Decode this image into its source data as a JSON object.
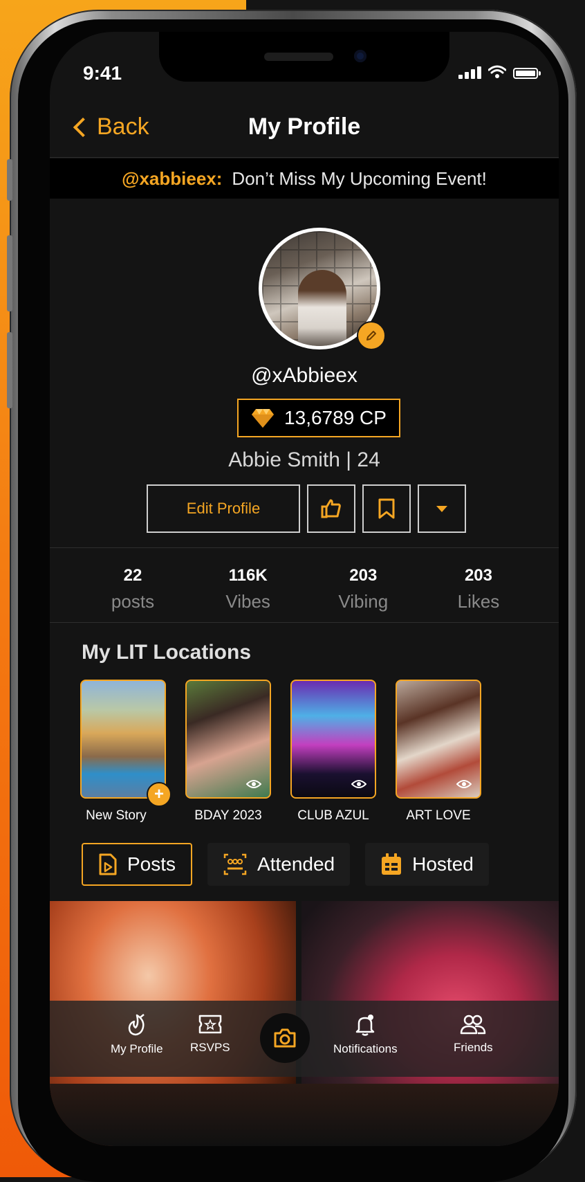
{
  "status_bar": {
    "time": "9:41"
  },
  "nav": {
    "back_label": "Back",
    "title": "My Profile"
  },
  "banner": {
    "handle": "@xabbieex:",
    "message": "Don’t Miss My Upcoming Event!"
  },
  "profile": {
    "username": "@xAbbieex",
    "points": "13,6789 CP",
    "name_age": "Abbie Smith | 24",
    "edit_profile_label": "Edit Profile"
  },
  "stats": [
    {
      "value": "22",
      "label": "posts"
    },
    {
      "value": "116K",
      "label": "Vibes"
    },
    {
      "value": "203",
      "label": "Vibing"
    },
    {
      "value": "203",
      "label": "Likes"
    }
  ],
  "locations": {
    "title": "My LIT Locations",
    "items": [
      {
        "label": "New Story"
      },
      {
        "label": "BDAY 2023"
      },
      {
        "label": "CLUB AZUL"
      },
      {
        "label": "ART LOVE"
      }
    ]
  },
  "tabs": [
    {
      "label": "Posts",
      "active": true
    },
    {
      "label": "Attended",
      "active": false
    },
    {
      "label": "Hosted",
      "active": false
    }
  ],
  "tabbar": {
    "items": [
      {
        "label": "My Profile"
      },
      {
        "label": "RSVPS"
      },
      {
        "label": "Notifications"
      },
      {
        "label": "Friends"
      }
    ]
  },
  "colors": {
    "accent": "#f5a623",
    "background": "#141414",
    "frame_orange": "#f47a12"
  },
  "icons": [
    "chevron-left-icon",
    "thumbs-up-icon",
    "bookmark-icon",
    "caret-down-icon",
    "pencil-icon",
    "diamond-icon",
    "eye-icon",
    "plus-icon",
    "posts-icon",
    "attended-icon",
    "hosted-icon",
    "profile-logo-icon",
    "ticket-icon",
    "camera-icon",
    "bell-icon",
    "friends-icon"
  ]
}
